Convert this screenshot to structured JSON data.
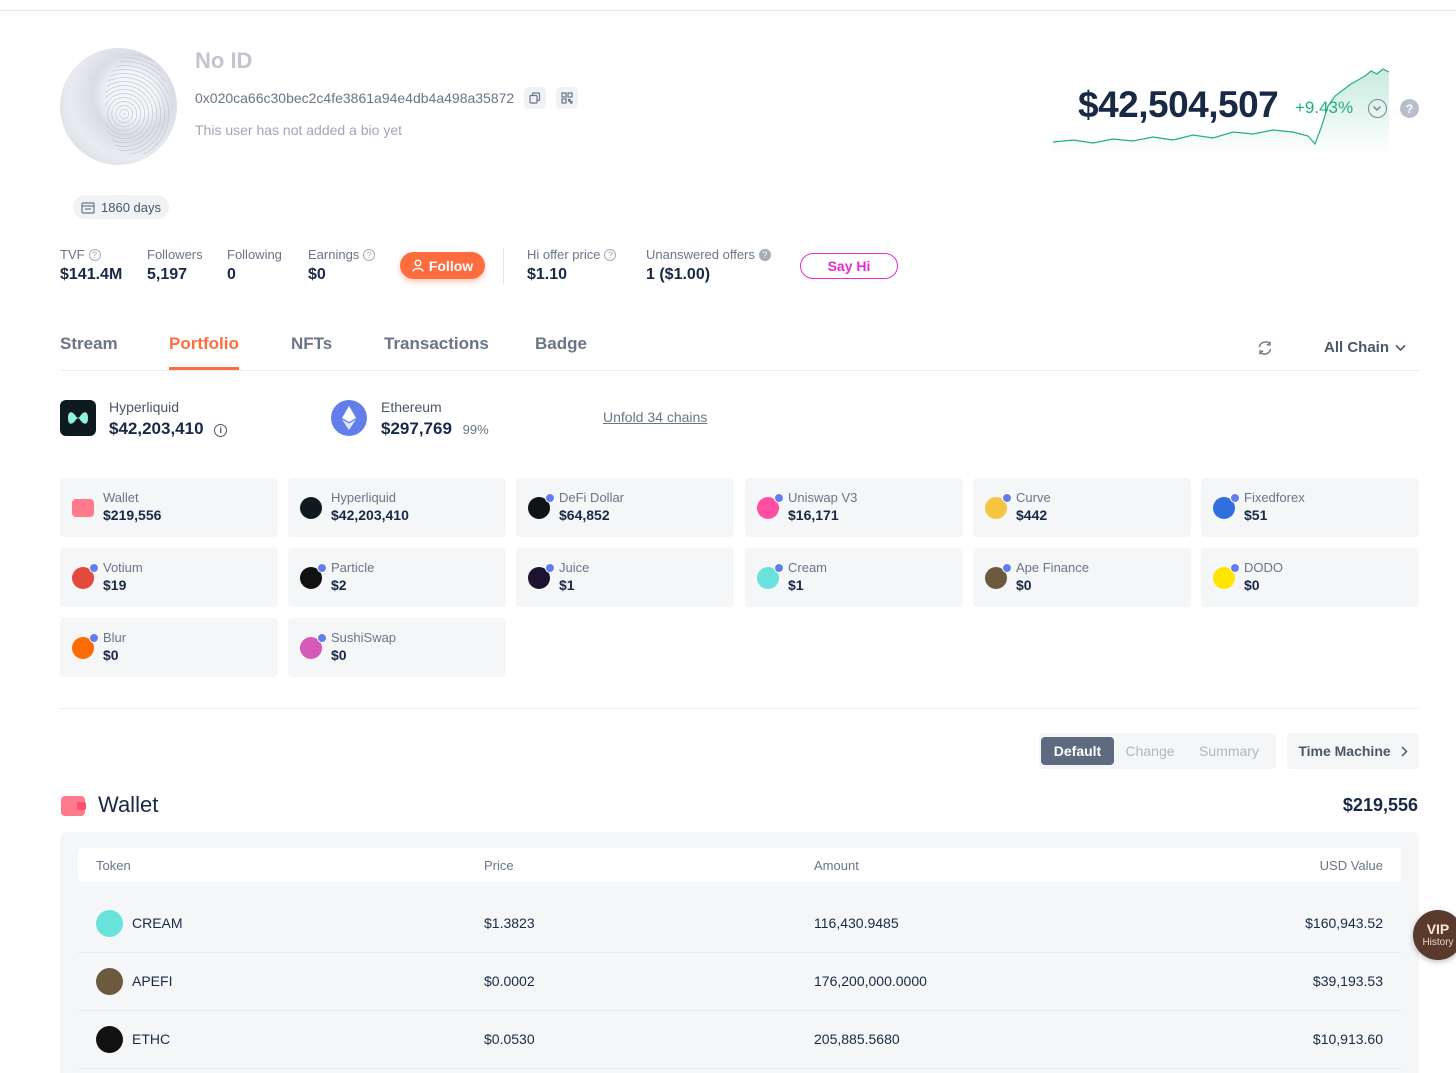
{
  "profile": {
    "name": "No ID",
    "address": "0x020ca66c30bec2c4fe3861a94e4db4a498a35872",
    "bio": "This user has not added a bio yet",
    "days": "1860 days"
  },
  "networth": {
    "value": "$42,504,507",
    "change": "+9.43%",
    "help_glyph": "?"
  },
  "stats": {
    "tvf": {
      "label": "TVF",
      "value": "$141.4M"
    },
    "followers": {
      "label": "Followers",
      "value": "5,197"
    },
    "following": {
      "label": "Following",
      "value": "0"
    },
    "earnings": {
      "label": "Earnings",
      "value": "$0"
    },
    "follow_label": "Follow",
    "hi_offer": {
      "label": "Hi offer price",
      "value": "$1.10"
    },
    "unanswered": {
      "label": "Unanswered offers",
      "value": "1 ($1.00)"
    },
    "sayhi_label": "Say Hi"
  },
  "tabs": [
    "Stream",
    "Portfolio",
    "NFTs",
    "Transactions",
    "Badge"
  ],
  "active_tab": "Portfolio",
  "chain_filter": "All Chain",
  "chains": [
    {
      "name": "Hyperliquid",
      "value": "$42,203,410",
      "pct": ""
    },
    {
      "name": "Ethereum",
      "value": "$297,769",
      "pct": "99%"
    }
  ],
  "unfold_label": "Unfold 34 chains",
  "protocols": [
    {
      "name": "Wallet",
      "value": "$219,556",
      "color": "#ff7a8a"
    },
    {
      "name": "Hyperliquid",
      "value": "$42,203,410",
      "color": "#0f1a1f"
    },
    {
      "name": "DeFi Dollar",
      "value": "$64,852",
      "color": "#101214"
    },
    {
      "name": "Uniswap V3",
      "value": "$16,171",
      "color": "#ff4fa3"
    },
    {
      "name": "Curve",
      "value": "$442",
      "color": "#f5c542"
    },
    {
      "name": "Fixedforex",
      "value": "$51",
      "color": "#2f6fe0"
    },
    {
      "name": "Votium",
      "value": "$19",
      "color": "#e44a3c"
    },
    {
      "name": "Particle",
      "value": "$2",
      "color": "#111111"
    },
    {
      "name": "Juice",
      "value": "$1",
      "color": "#1d1230"
    },
    {
      "name": "Cream",
      "value": "$1",
      "color": "#69e2dc"
    },
    {
      "name": "Ape Finance",
      "value": "$0",
      "color": "#6b5a3e"
    },
    {
      "name": "DODO",
      "value": "$0",
      "color": "#ffe500"
    },
    {
      "name": "Blur",
      "value": "$0",
      "color": "#ff6b00"
    },
    {
      "name": "SushiSwap",
      "value": "$0",
      "color": "#d65ab8"
    }
  ],
  "view_modes": [
    "Default",
    "Change",
    "Summary"
  ],
  "active_view": "Default",
  "time_machine_label": "Time Machine",
  "wallet": {
    "title": "Wallet",
    "total": "$219,556",
    "columns": [
      "Token",
      "Price",
      "Amount",
      "USD Value"
    ],
    "rows": [
      {
        "token": "CREAM",
        "price": "$1.3823",
        "amount": "116,430.9485",
        "usd": "$160,943.52",
        "color": "#69e2dc"
      },
      {
        "token": "APEFI",
        "price": "$0.0002",
        "amount": "176,200,000.0000",
        "usd": "$39,193.53",
        "color": "#6b5a3e"
      },
      {
        "token": "ETHC",
        "price": "$0.0530",
        "amount": "205,885.5680",
        "usd": "$10,913.60",
        "color": "#111111"
      }
    ]
  },
  "vip": {
    "title": "VIP",
    "subtitle": "History"
  },
  "colors": {
    "accent": "#ff6d3f",
    "positive": "#21b07b",
    "sayhi": "#e62cd1"
  }
}
